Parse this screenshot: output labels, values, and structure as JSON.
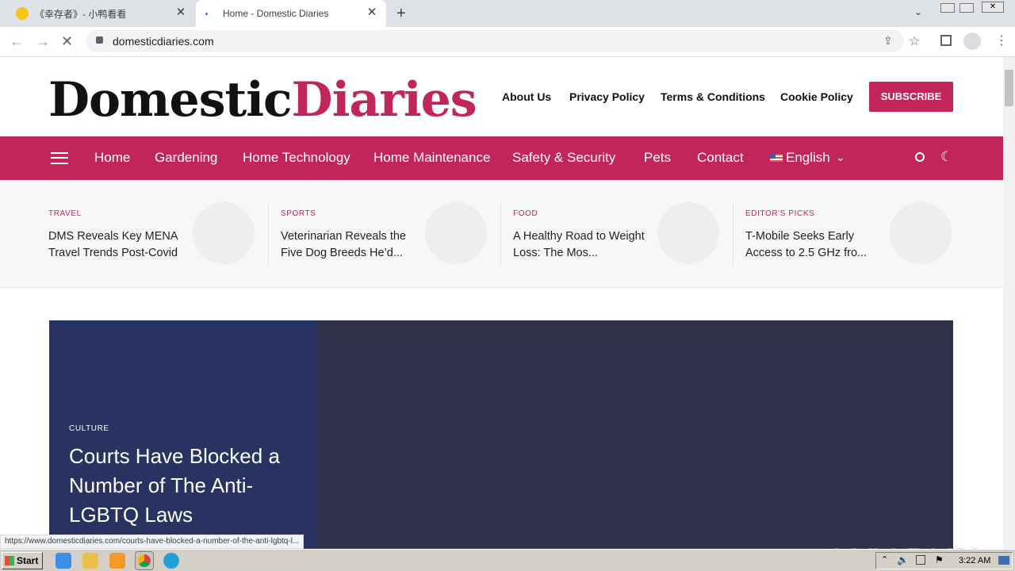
{
  "browser": {
    "tabs": [
      {
        "title": "《幸存者》- 小鸭看看",
        "active": false
      },
      {
        "title": "Home - Domestic Diaries",
        "active": true
      }
    ],
    "url": "domesticdiaries.com",
    "status_url": "https://www.domesticdiaries.com/courts-have-blocked-a-number-of-the-anti-lgbtq-l..."
  },
  "site": {
    "logo": {
      "part1": "Domestic",
      "part2": "Diaries"
    },
    "top_links": [
      "About Us",
      "Privacy Policy",
      "Terms & Conditions",
      "Cookie Policy"
    ],
    "subscribe_label": "SUBSCRIBE",
    "nav": [
      "Home",
      "Gardening",
      "Home Technology",
      "Home Maintenance",
      "Safety & Security",
      "Pets",
      "Contact"
    ],
    "language": "English",
    "ticker": [
      {
        "category": "TRAVEL",
        "headline": "DMS Reveals Key MENA Travel Trends Post-Covid"
      },
      {
        "category": "SPORTS",
        "headline": "Veterinarian Reveals the Five Dog Breeds He’d..."
      },
      {
        "category": "FOOD",
        "headline": "A Healthy Road to Weight Loss: The Mos..."
      },
      {
        "category": "EDITOR'S PICKS",
        "headline": "T-Mobile Seeks Early Access to 2.5 GHz fro..."
      }
    ],
    "hero": {
      "category": "CULTURE",
      "title": "Courts Have Blocked a Number of The Anti-LGBTQ Laws"
    }
  },
  "watermark": "ANY RUN",
  "taskbar": {
    "start_label": "Start",
    "clock": "3:22 AM"
  },
  "colors": {
    "brand": "#c2255c",
    "hero_left": "#283361",
    "hero_bg": "#2e3148"
  }
}
